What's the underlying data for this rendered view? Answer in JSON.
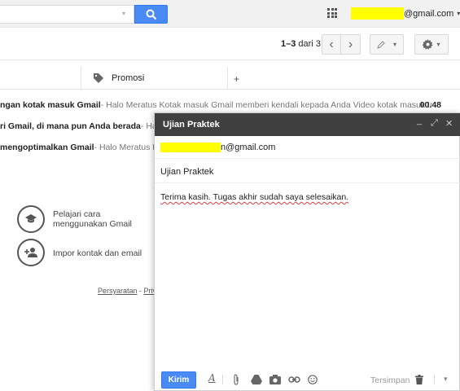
{
  "topbar": {
    "search_caret": "▾",
    "account_suffix": "@gmail.com",
    "account_caret": "▾"
  },
  "toolbar": {
    "range": "1–3",
    "of_label": "dari 3",
    "prev": "‹",
    "next": "›",
    "settings_caret": "▾",
    "pen_caret": "▾"
  },
  "tabs": {
    "promotions_label": "Promosi",
    "add_label": "+"
  },
  "mail_rows": [
    {
      "subject": "ngan kotak masuk Gmail",
      "snippet": " - Halo Meratus Kotak masuk Gmail memberi kendali kepada Anda Video kotak masuk Ir",
      "time": "00.48"
    },
    {
      "subject": "ri Gmail, di mana pun Anda berada",
      "snippet": " - Halo",
      "time": ""
    },
    {
      "subject": "mengoptimalkan Gmail",
      "snippet": " - Halo Meratus Kiat",
      "time": ""
    }
  ],
  "getting_started": {
    "learn_line1": "Pelajari cara",
    "learn_line2": "menggunakan Gmail",
    "import_label": "Impor kontak dan email"
  },
  "footer": {
    "terms": "Persyaratan",
    "sep": " - ",
    "privacy": "Privasi"
  },
  "compose": {
    "title": "Ujian Praktek",
    "minimize": "_",
    "expand": "⤢",
    "close": "✕",
    "to_suffix": "@gmail.com",
    "to_prefix_char": "n",
    "subject": "Ujian Praktek",
    "body": "Terima kasih. Tugas akhir sudah saya selesaikan.",
    "send_label": "Kirim",
    "saved_label": "Tersimpan",
    "more_caret": "▾"
  },
  "colors": {
    "accent_blue": "#4a8af4",
    "compose_header": "#404040",
    "redaction": "#ffff00"
  }
}
